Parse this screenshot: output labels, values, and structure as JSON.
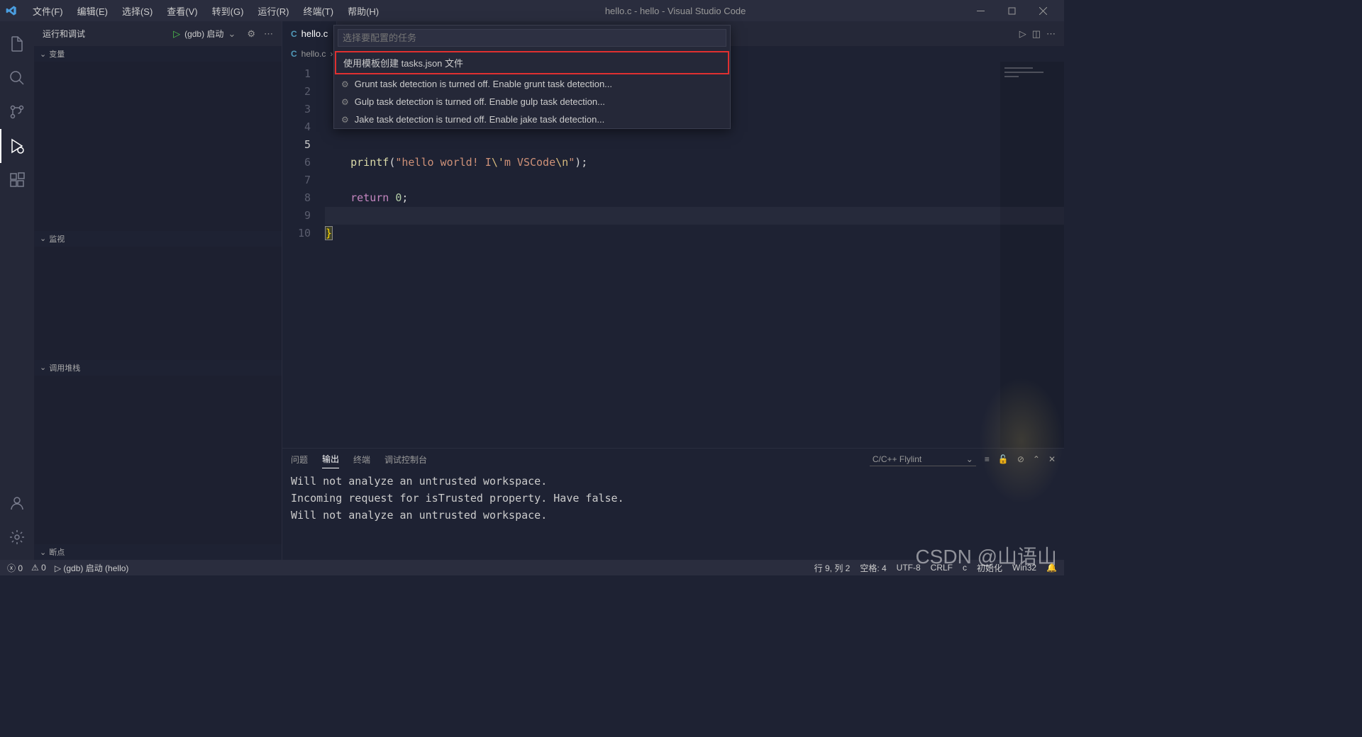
{
  "title": "hello.c - hello - Visual Studio Code",
  "menu": [
    "文件(F)",
    "编辑(E)",
    "选择(S)",
    "查看(V)",
    "转到(G)",
    "运行(R)",
    "终端(T)",
    "帮助(H)"
  ],
  "debug": {
    "label": "运行和调试",
    "config": "(gdb) 启动"
  },
  "sections": {
    "variables": "变量",
    "watch": "监视",
    "callstack": "调用堆栈",
    "breakpoints": "断点"
  },
  "tab": {
    "name": "hello.c"
  },
  "breadcrumb": {
    "file": "hello.c",
    "symbol": "..."
  },
  "quickpick": {
    "placeholder": "选择要配置的任务",
    "items": [
      {
        "label": "使用模板创建 tasks.json 文件",
        "highlighted": true,
        "gear": false
      },
      {
        "label": "Grunt task detection is turned off. Enable grunt task detection...",
        "gear": true
      },
      {
        "label": "Gulp task detection is turned off. Enable gulp task detection...",
        "gear": true
      },
      {
        "label": "Jake task detection is turned off. Enable jake task detection...",
        "gear": true
      }
    ]
  },
  "code": {
    "lines": [
      1,
      2,
      3,
      4,
      5,
      6,
      7,
      8,
      9,
      10
    ],
    "line5_printf": "printf",
    "line5_str1": "\"hello world! I",
    "line5_esc1": "\\'",
    "line5_str2": "m VSCode",
    "line5_esc2": "\\n",
    "line5_str3": "\"",
    "line7_return": "return",
    "line7_num": "0",
    "line9_brace": "}"
  },
  "panel": {
    "tabs": [
      "问题",
      "输出",
      "终端",
      "调试控制台"
    ],
    "active": "输出",
    "dropdown": "C/C++ Flylint",
    "lines": [
      "Will not analyze an untrusted workspace.",
      "Incoming request for isTrusted property. Have false.",
      "Will not analyze an untrusted workspace."
    ]
  },
  "status": {
    "errors": "0",
    "warnings": "0",
    "debug": "(gdb) 启动 (hello)",
    "lncol": "行 9, 列 2",
    "spaces": "空格: 4",
    "encoding": "UTF-8",
    "eol": "CRLF",
    "lang": "c",
    "init": "初始化",
    "win32": "Win32"
  },
  "watermark": "CSDN @山语山"
}
